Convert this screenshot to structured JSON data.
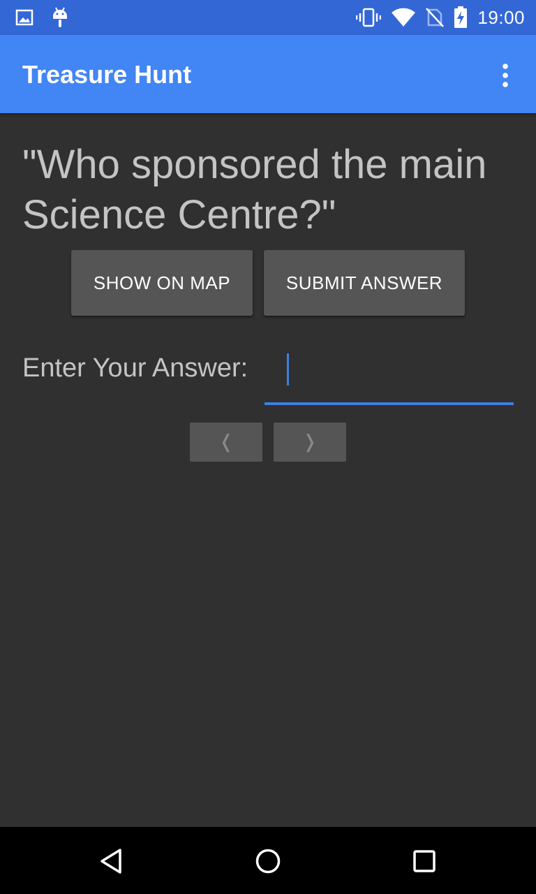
{
  "status_bar": {
    "time": "19:00",
    "left_icons": [
      "image-icon",
      "android-icon"
    ],
    "right_icons": [
      "vibrate-icon",
      "wifi-icon",
      "no-sim-icon",
      "battery-charging-icon"
    ]
  },
  "app_bar": {
    "title": "Treasure Hunt",
    "menu_icon": "more-vert-icon"
  },
  "question": {
    "text": "\"Who sponsored the main Science Centre?\""
  },
  "buttons": {
    "show_on_map": "SHOW ON MAP",
    "submit_answer": "SUBMIT ANSWER"
  },
  "answer": {
    "label": "Enter Your Answer:",
    "value": ""
  },
  "navigation": {
    "prev_label": "❬",
    "next_label": "❭"
  },
  "system_nav": {
    "icons": [
      "back-icon",
      "home-icon",
      "recent-apps-icon"
    ]
  },
  "colors": {
    "status_bar": "#3367d6",
    "app_bar": "#4285f4",
    "background": "#303030",
    "button": "#555555",
    "accent": "#3f7fe0"
  }
}
